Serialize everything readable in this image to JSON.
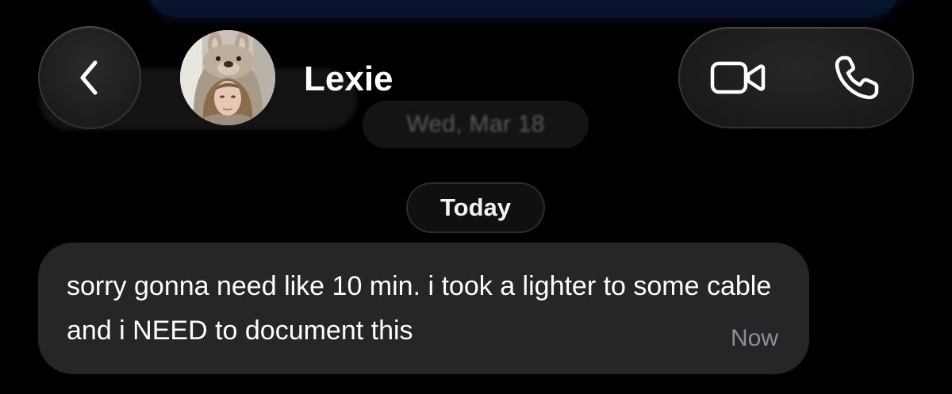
{
  "header": {
    "contact_name": "Lexie"
  },
  "background": {
    "date_divider": "Wed, Mar 18"
  },
  "conversation": {
    "date_divider": "Today",
    "messages": [
      {
        "text": "sorry gonna need like 10 min. i took a lighter to some cable and i NEED to document this",
        "time": "Now"
      }
    ]
  },
  "icons": {
    "back": "chevron-left-icon",
    "video": "video-camera-icon",
    "call": "phone-icon"
  },
  "colors": {
    "background": "#000000",
    "bubble": "#262628",
    "timestamp": "#8e8e93"
  }
}
